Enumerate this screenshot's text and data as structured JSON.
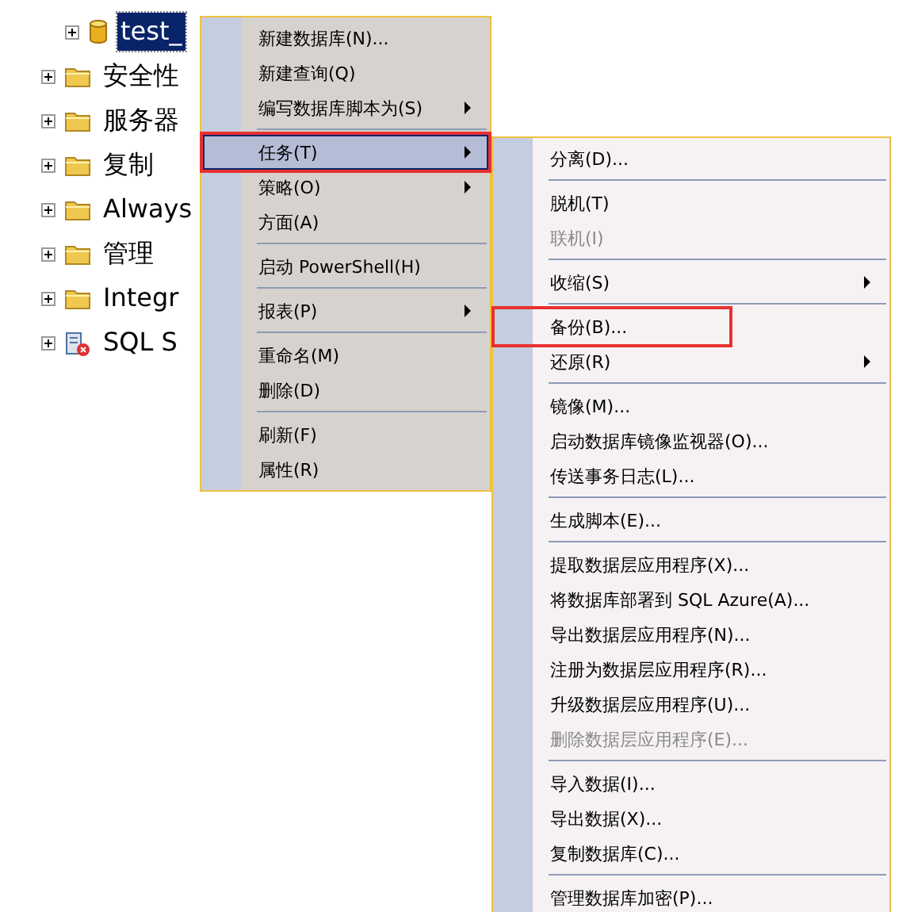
{
  "tree": [
    {
      "label": "test_",
      "kind": "database",
      "selected": true,
      "indent": true
    },
    {
      "label": "安全性",
      "kind": "folder",
      "selected": false,
      "indent": false
    },
    {
      "label": "服务器",
      "kind": "folder",
      "selected": false,
      "indent": false
    },
    {
      "label": "复制",
      "kind": "folder",
      "selected": false,
      "indent": false
    },
    {
      "label": "Always",
      "kind": "folder",
      "selected": false,
      "indent": false
    },
    {
      "label": "管理",
      "kind": "folder",
      "selected": false,
      "indent": false
    },
    {
      "label": "Integr",
      "kind": "folder",
      "selected": false,
      "indent": false
    },
    {
      "label": "SQL S",
      "kind": "agent",
      "selected": false,
      "indent": false
    }
  ],
  "context_menu": [
    {
      "kind": "item",
      "label": "新建数据库(N)...",
      "submenu": false,
      "selected": false,
      "disabled": false,
      "outlined": false
    },
    {
      "kind": "item",
      "label": "新建查询(Q)",
      "submenu": false,
      "selected": false,
      "disabled": false,
      "outlined": false
    },
    {
      "kind": "item",
      "label": "编写数据库脚本为(S)",
      "submenu": true,
      "selected": false,
      "disabled": false,
      "outlined": false
    },
    {
      "kind": "separator"
    },
    {
      "kind": "item",
      "label": "任务(T)",
      "submenu": true,
      "selected": true,
      "disabled": false,
      "outlined": true
    },
    {
      "kind": "item",
      "label": "策略(O)",
      "submenu": true,
      "selected": false,
      "disabled": false,
      "outlined": false
    },
    {
      "kind": "item",
      "label": "方面(A)",
      "submenu": false,
      "selected": false,
      "disabled": false,
      "outlined": false
    },
    {
      "kind": "separator"
    },
    {
      "kind": "item",
      "label": "启动 PowerShell(H)",
      "submenu": false,
      "selected": false,
      "disabled": false,
      "outlined": false
    },
    {
      "kind": "separator"
    },
    {
      "kind": "item",
      "label": "报表(P)",
      "submenu": true,
      "selected": false,
      "disabled": false,
      "outlined": false
    },
    {
      "kind": "separator"
    },
    {
      "kind": "item",
      "label": "重命名(M)",
      "submenu": false,
      "selected": false,
      "disabled": false,
      "outlined": false
    },
    {
      "kind": "item",
      "label": "删除(D)",
      "submenu": false,
      "selected": false,
      "disabled": false,
      "outlined": false
    },
    {
      "kind": "separator"
    },
    {
      "kind": "item",
      "label": "刷新(F)",
      "submenu": false,
      "selected": false,
      "disabled": false,
      "outlined": false
    },
    {
      "kind": "item",
      "label": "属性(R)",
      "submenu": false,
      "selected": false,
      "disabled": false,
      "outlined": false
    }
  ],
  "tasks_submenu": [
    {
      "kind": "item",
      "label": "分离(D)...",
      "submenu": false,
      "selected": false,
      "disabled": false,
      "outlined": false
    },
    {
      "kind": "separator"
    },
    {
      "kind": "item",
      "label": "脱机(T)",
      "submenu": false,
      "selected": false,
      "disabled": false,
      "outlined": false
    },
    {
      "kind": "item",
      "label": "联机(I)",
      "submenu": false,
      "selected": false,
      "disabled": true,
      "outlined": false
    },
    {
      "kind": "separator"
    },
    {
      "kind": "item",
      "label": "收缩(S)",
      "submenu": true,
      "selected": false,
      "disabled": false,
      "outlined": false
    },
    {
      "kind": "separator"
    },
    {
      "kind": "item",
      "label": "备份(B)...",
      "submenu": false,
      "selected": false,
      "disabled": false,
      "outlined": true
    },
    {
      "kind": "item",
      "label": "还原(R)",
      "submenu": true,
      "selected": false,
      "disabled": false,
      "outlined": false
    },
    {
      "kind": "separator"
    },
    {
      "kind": "item",
      "label": "镜像(M)...",
      "submenu": false,
      "selected": false,
      "disabled": false,
      "outlined": false
    },
    {
      "kind": "item",
      "label": "启动数据库镜像监视器(O)...",
      "submenu": false,
      "selected": false,
      "disabled": false,
      "outlined": false
    },
    {
      "kind": "item",
      "label": "传送事务日志(L)...",
      "submenu": false,
      "selected": false,
      "disabled": false,
      "outlined": false
    },
    {
      "kind": "separator"
    },
    {
      "kind": "item",
      "label": "生成脚本(E)...",
      "submenu": false,
      "selected": false,
      "disabled": false,
      "outlined": false
    },
    {
      "kind": "separator"
    },
    {
      "kind": "item",
      "label": "提取数据层应用程序(X)...",
      "submenu": false,
      "selected": false,
      "disabled": false,
      "outlined": false
    },
    {
      "kind": "item",
      "label": "将数据库部署到 SQL Azure(A)...",
      "submenu": false,
      "selected": false,
      "disabled": false,
      "outlined": false
    },
    {
      "kind": "item",
      "label": "导出数据层应用程序(N)...",
      "submenu": false,
      "selected": false,
      "disabled": false,
      "outlined": false
    },
    {
      "kind": "item",
      "label": "注册为数据层应用程序(R)...",
      "submenu": false,
      "selected": false,
      "disabled": false,
      "outlined": false
    },
    {
      "kind": "item",
      "label": "升级数据层应用程序(U)...",
      "submenu": false,
      "selected": false,
      "disabled": false,
      "outlined": false
    },
    {
      "kind": "item",
      "label": "删除数据层应用程序(E)...",
      "submenu": false,
      "selected": false,
      "disabled": true,
      "outlined": false
    },
    {
      "kind": "separator"
    },
    {
      "kind": "item",
      "label": "导入数据(I)...",
      "submenu": false,
      "selected": false,
      "disabled": false,
      "outlined": false
    },
    {
      "kind": "item",
      "label": "导出数据(X)...",
      "submenu": false,
      "selected": false,
      "disabled": false,
      "outlined": false
    },
    {
      "kind": "item",
      "label": "复制数据库(C)...",
      "submenu": false,
      "selected": false,
      "disabled": false,
      "outlined": false
    },
    {
      "kind": "separator"
    },
    {
      "kind": "item",
      "label": "管理数据库加密(P)...",
      "submenu": false,
      "selected": false,
      "disabled": false,
      "outlined": false
    }
  ]
}
